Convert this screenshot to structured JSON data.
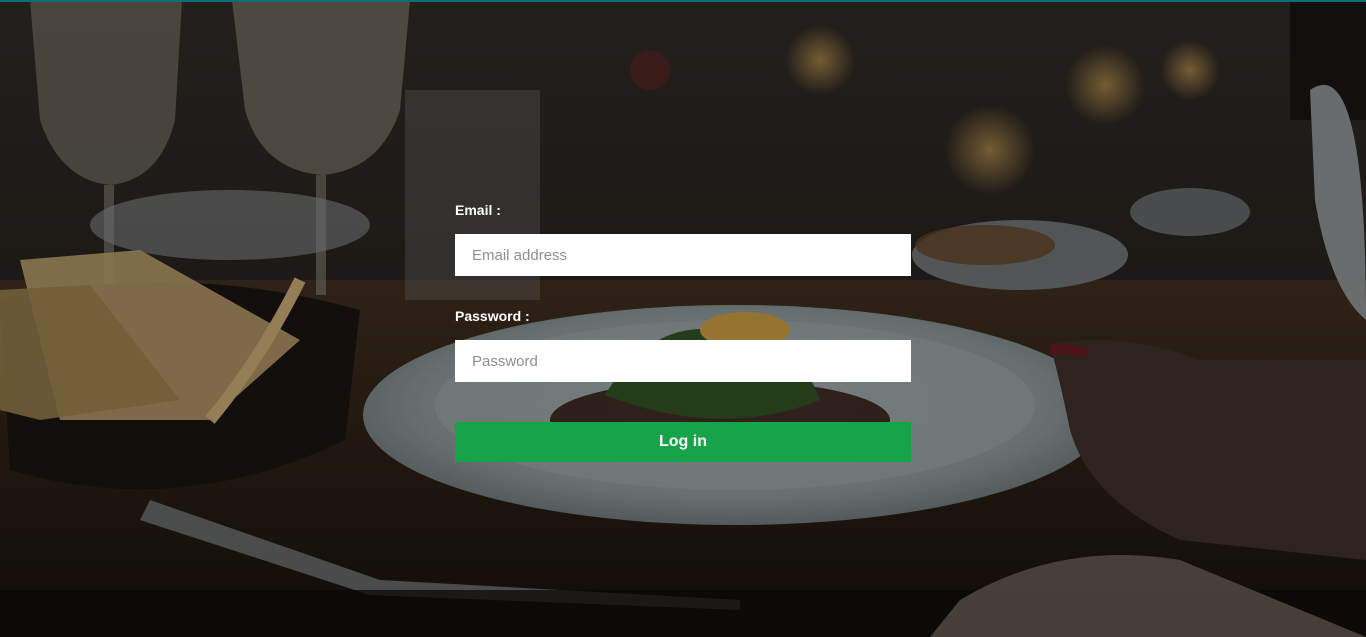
{
  "login": {
    "email_label": "Email :",
    "email_placeholder": "Email address",
    "email_value": "",
    "password_label": "Password :",
    "password_placeholder": "Password",
    "password_value": "",
    "submit_label": "Log in"
  },
  "colors": {
    "accent_top_bar": "#0b6f73",
    "button_green": "#17a34a",
    "label_text": "#ffffff",
    "input_bg": "#ffffff"
  },
  "background": {
    "icon": "restaurant-table-photo"
  }
}
